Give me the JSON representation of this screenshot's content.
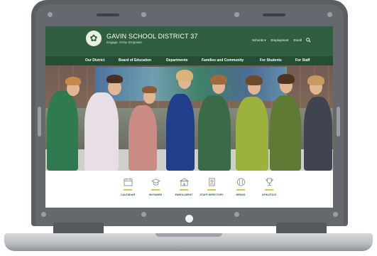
{
  "site": {
    "title": "GAVIN SCHOOL DISTRICT 37",
    "tagline": "Engage. Grow. Empower."
  },
  "utility_nav": [
    "Schools ▾",
    "Employment",
    "Enroll"
  ],
  "main_nav": [
    "Our District",
    "Board of Education",
    "Departments",
    "Families and Community",
    "For Students",
    "For Staff"
  ],
  "quick_links": [
    {
      "label": "CALENDAR",
      "icon": "calendar-icon"
    },
    {
      "label": "SKYWARD",
      "icon": "graduation-cap-icon"
    },
    {
      "label": "ENROLLMENT",
      "icon": "school-building-icon"
    },
    {
      "label": "STAFF DIRECTORY",
      "icon": "id-card-icon"
    },
    {
      "label": "MENUS",
      "icon": "utensils-icon"
    },
    {
      "label": "ATHLETICS",
      "icon": "trophy-icon"
    }
  ],
  "colors": {
    "brand_green": "#2f5f3e",
    "nav_green": "#254d33",
    "accent_gold": "#e3c23b"
  }
}
